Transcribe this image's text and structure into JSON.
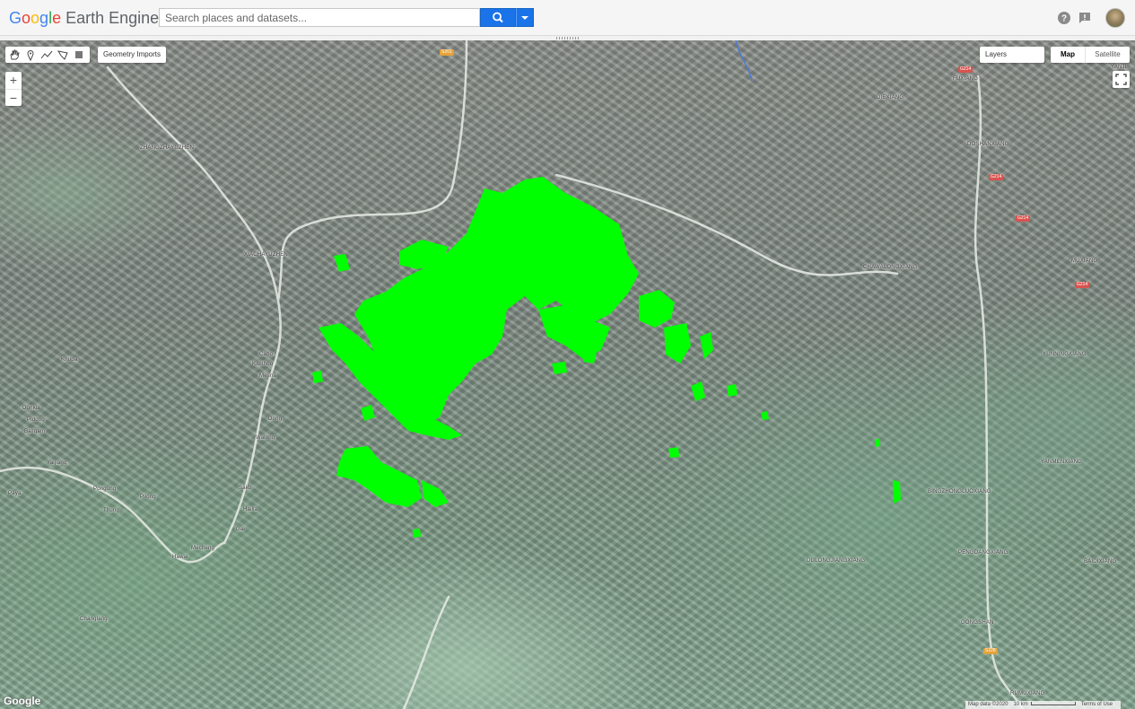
{
  "header": {
    "logo_google": "Google",
    "logo_product": "Earth Engine",
    "search_placeholder": "Search places and datasets..."
  },
  "map_controls": {
    "geometry_imports": "Geometry Imports",
    "zoom_in": "+",
    "zoom_out": "−",
    "layers": "Layers",
    "map_type_options": [
      "Map",
      "Satellite"
    ],
    "selected_map_type": "Map"
  },
  "attribution": {
    "google_logo": "Google",
    "map_data": "Map data ©2020",
    "scale": "10 km",
    "terms": "Terms of Use"
  },
  "places": [
    "ZHANGZHAYUZHEN",
    "XIACHAYUZHEN",
    "Caho",
    "Kibithoo",
    "Mesna",
    "Dong",
    "Walong",
    "Khupa",
    "Donkia",
    "Pidong",
    "Ballgam",
    "Yaijiang",
    "Paya",
    "Pongung",
    "Pilong",
    "Thung",
    "Sakti",
    "Hailla",
    "Gai",
    "Mecheng",
    "Hawai",
    "Changlang",
    "FUXIANG",
    "DIEXIANG",
    "DOSHANXIANG",
    "CHAWALONGXIANG",
    "YUNNINGXIANG",
    "YANMENXIANG",
    "BINGZHONGLUOXIANG",
    "DULONGJIANGXIANG",
    "PENGDANGXIANG",
    "GONGSHAN",
    "BAIDIXIANG",
    "MUXIANG",
    "RUMUXIANG",
    "YANJI"
  ],
  "roads": [
    "S201",
    "G214",
    "G214",
    "G214",
    "G214",
    "S228"
  ],
  "colors": {
    "accent": "#1a73e8",
    "overlay": "#00ff00"
  }
}
